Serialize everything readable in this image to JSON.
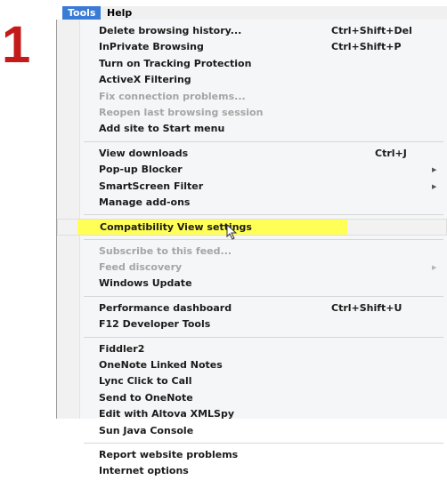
{
  "step_number": "1",
  "menubar": {
    "items": [
      {
        "label": "Tools",
        "active": true
      },
      {
        "label": "Help",
        "active": false
      }
    ]
  },
  "menu": {
    "groups": [
      [
        {
          "label": "Delete browsing history...",
          "shortcut": "Ctrl+Shift+Del"
        },
        {
          "label": "InPrivate Browsing",
          "shortcut": "Ctrl+Shift+P"
        },
        {
          "label": "Turn on Tracking Protection"
        },
        {
          "label": "ActiveX Filtering"
        },
        {
          "label": "Fix connection problems...",
          "disabled": true
        },
        {
          "label": "Reopen last browsing session",
          "disabled": true
        },
        {
          "label": "Add site to Start menu"
        }
      ],
      [
        {
          "label": "View downloads",
          "shortcut": "Ctrl+J"
        },
        {
          "label": "Pop-up Blocker",
          "submenu": true
        },
        {
          "label": "SmartScreen Filter",
          "submenu": true
        },
        {
          "label": "Manage add-ons"
        }
      ],
      [
        {
          "label": "Compatibility View settings",
          "highlighted": true
        }
      ],
      [
        {
          "label": "Subscribe to this feed...",
          "disabled": true
        },
        {
          "label": "Feed discovery",
          "disabled": true,
          "submenu": true
        },
        {
          "label": "Windows Update"
        }
      ],
      [
        {
          "label": "Performance dashboard",
          "shortcut": "Ctrl+Shift+U"
        },
        {
          "label": "F12 Developer Tools"
        }
      ],
      [
        {
          "label": "Fiddler2"
        },
        {
          "label": "OneNote Linked Notes"
        },
        {
          "label": "Lync Click to Call"
        },
        {
          "label": "Send to OneNote"
        },
        {
          "label": "Edit with Altova XMLSpy"
        },
        {
          "label": "Sun Java Console"
        }
      ],
      [
        {
          "label": "Report website problems"
        },
        {
          "label": "Internet options"
        }
      ]
    ]
  },
  "colors": {
    "step_number": "#c41a1a",
    "highlight_marker": "#ffff55",
    "menubar_active": "#3a7bd5"
  },
  "icons": {
    "submenu": "triangle-right-icon",
    "pointer": "mouse-pointer-icon"
  }
}
